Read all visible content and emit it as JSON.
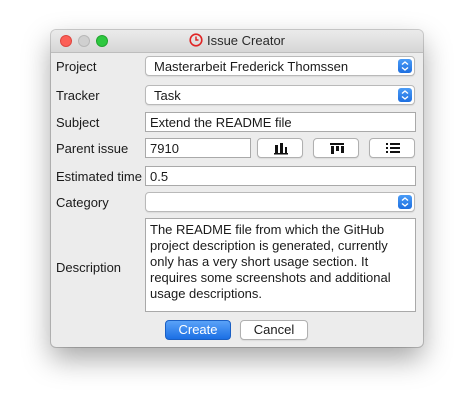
{
  "window": {
    "title": "Issue Creator"
  },
  "form": {
    "project": {
      "label": "Project",
      "value": "Masterarbeit Frederick Thomssen"
    },
    "tracker": {
      "label": "Tracker",
      "value": "Task"
    },
    "subject": {
      "label": "Subject",
      "value": "Extend the README file"
    },
    "parent_issue": {
      "label": "Parent issue",
      "value": "7910"
    },
    "estimated_time": {
      "label": "Estimated time",
      "value": "0.5"
    },
    "category": {
      "label": "Category",
      "value": ""
    },
    "description": {
      "label": "Description",
      "value": "The README file from which the GitHub project description is generated, currently only has a very short usage section. It requires some screenshots and additional usage descriptions."
    }
  },
  "parent_issue_tools": [
    "bar-chart-icon",
    "kanban-icon",
    "list-icon"
  ],
  "buttons": {
    "create": "Create",
    "cancel": "Cancel"
  },
  "colors": {
    "accent": "#1b6fe4",
    "close": "#fc5f57",
    "zoom": "#2ec840",
    "clock": "#e02424"
  }
}
